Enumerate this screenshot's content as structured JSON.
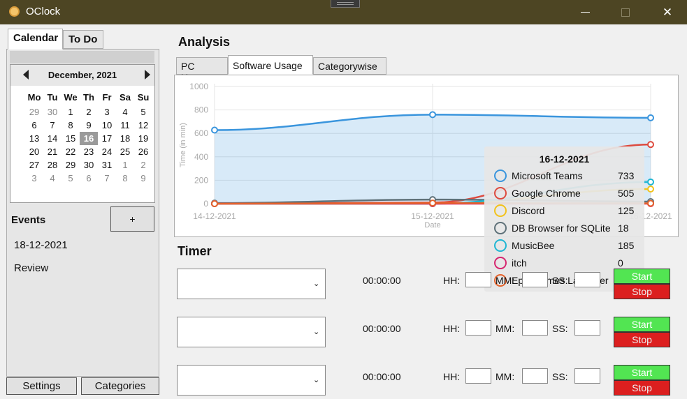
{
  "window": {
    "title": "OClock"
  },
  "left_tabs": {
    "calendar": "Calendar",
    "todo": "To Do"
  },
  "calendar": {
    "month": "December, 2021",
    "weekdays": [
      "Mo",
      "Tu",
      "We",
      "Th",
      "Fr",
      "Sa",
      "Su"
    ],
    "days": [
      [
        "29",
        "30",
        "1",
        "2",
        "3",
        "4",
        "5"
      ],
      [
        "6",
        "7",
        "8",
        "9",
        "10",
        "11",
        "12"
      ],
      [
        "13",
        "14",
        "15",
        "16",
        "17",
        "18",
        "19"
      ],
      [
        "20",
        "21",
        "22",
        "23",
        "24",
        "25",
        "26"
      ],
      [
        "27",
        "28",
        "29",
        "30",
        "31",
        "1",
        "2"
      ],
      [
        "3",
        "4",
        "5",
        "6",
        "7",
        "8",
        "9"
      ]
    ],
    "today": "16"
  },
  "events": {
    "label": "Events",
    "add_label": "+",
    "items": [
      "18-12-2021",
      "Review"
    ]
  },
  "bottom_buttons": {
    "settings": "Settings",
    "categories": "Categories"
  },
  "analysis": {
    "title": "Analysis",
    "tabs": [
      "PC Usage",
      "Software Usage",
      "Categorywise"
    ]
  },
  "chart_data": {
    "type": "area",
    "xlabel": "Date",
    "ylabel": "Time (in min)",
    "ylim": [
      0,
      1000
    ],
    "yticks": [
      "0",
      "200",
      "400",
      "600",
      "800",
      "1000"
    ],
    "categories": [
      "14-12-2021",
      "15-12-2021",
      "16-12-2021"
    ],
    "series": [
      {
        "name": "Microsoft Teams",
        "values": [
          628,
          760,
          733
        ],
        "color": "#3a95dd",
        "fill": true
      },
      {
        "name": "Google Chrome",
        "values": [
          0,
          10,
          505
        ],
        "color": "#dd4a3e"
      },
      {
        "name": "Discord",
        "values": [
          0,
          0,
          125
        ],
        "color": "#f2c21b"
      },
      {
        "name": "DB Browser for SQLite",
        "values": [
          5,
          35,
          18
        ],
        "color": "#5f7179"
      },
      {
        "name": "MusicBee",
        "values": [
          0,
          0,
          185
        ],
        "color": "#1fb6d3"
      },
      {
        "name": "itch",
        "values": [
          0,
          0,
          0
        ],
        "color": "#d6246e"
      },
      {
        "name": "Epic Games Launcher",
        "values": [
          0,
          5,
          3
        ],
        "color": "#e5622b"
      }
    ],
    "grid": true,
    "tooltip": {
      "title": "16-12-2021",
      "rows": [
        {
          "name": "Microsoft Teams",
          "value": "733",
          "color": "#3a95dd"
        },
        {
          "name": "Google Chrome",
          "value": "505",
          "color": "#dd4a3e"
        },
        {
          "name": "Discord",
          "value": "125",
          "color": "#f2c21b"
        },
        {
          "name": "DB Browser for SQLite",
          "value": "18",
          "color": "#5f7179"
        },
        {
          "name": "MusicBee",
          "value": "185",
          "color": "#1fb6d3"
        },
        {
          "name": "itch",
          "value": "0",
          "color": "#d6246e"
        },
        {
          "name": "Epic Games Launcher",
          "value": "3",
          "color": "#e5622b"
        }
      ]
    }
  },
  "timer": {
    "title": "Timer",
    "rows": [
      {
        "time": "00:00:00",
        "hh": "HH:",
        "mm": "MM:",
        "ss": "SS:",
        "start": "Start",
        "stop": "Stop"
      },
      {
        "time": "00:00:00",
        "hh": "HH:",
        "mm": "MM:",
        "ss": "SS:",
        "start": "Start",
        "stop": "Stop"
      },
      {
        "time": "00:00:00",
        "hh": "HH:",
        "mm": "MM:",
        "ss": "SS:",
        "start": "Start",
        "stop": "Stop"
      }
    ]
  }
}
